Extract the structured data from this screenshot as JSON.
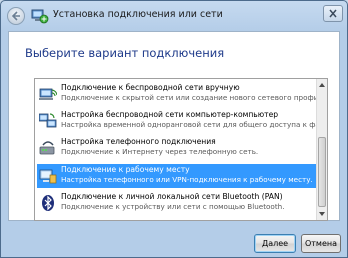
{
  "window": {
    "title": "Установка подключения или сети",
    "heading": "Выберите вариант подключения"
  },
  "options": [
    {
      "title": "Подключение к беспроводной сети вручную",
      "description": "Подключение к скрытой сети или создание нового сетевого профиля.",
      "icon": "wireless-network-icon",
      "selected": false
    },
    {
      "title": "Настройка беспроводной сети компьютер-компьютер",
      "description": "Настройка временной одноранговой сети для общего доступа к файлам или к Инт...",
      "icon": "computer-to-computer-icon",
      "selected": false
    },
    {
      "title": "Настройка телефонного подключения",
      "description": "Подключение к Интернету через телефонную сеть.",
      "icon": "dialup-modem-icon",
      "selected": false
    },
    {
      "title": "Подключение к рабочему месту",
      "description": "Настройка телефонного или VPN-подключения к рабочему месту.",
      "icon": "workplace-connection-icon",
      "selected": true
    },
    {
      "title": "Подключение к личной локальной сети Bluetooth (PAN)",
      "description": "Подключение к устройству или сети с помощью Bluetooth.",
      "icon": "bluetooth-icon",
      "selected": false
    }
  ],
  "buttons": {
    "next": "Далее",
    "cancel": "Отмена"
  },
  "colors": {
    "selection": "#3399ff",
    "heading": "#1e3a8a",
    "frame": "#b4cde8"
  }
}
